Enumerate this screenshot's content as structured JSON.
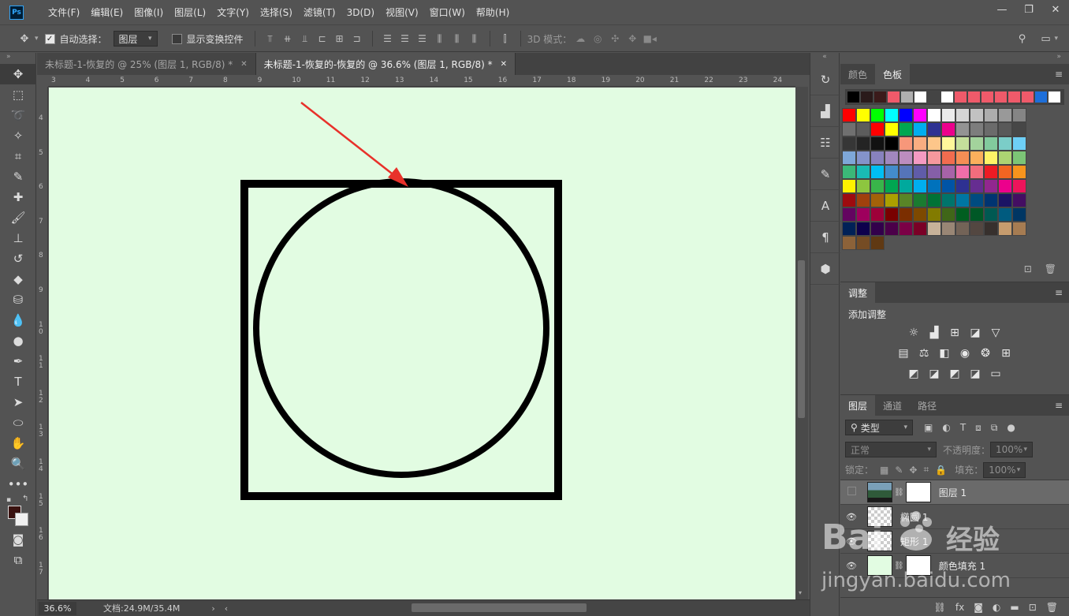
{
  "menubar": {
    "logo": "Ps",
    "items": [
      "文件(F)",
      "编辑(E)",
      "图像(I)",
      "图层(L)",
      "文字(Y)",
      "选择(S)",
      "滤镜(T)",
      "3D(D)",
      "视图(V)",
      "窗口(W)",
      "帮助(H)"
    ],
    "window_controls": [
      "—",
      "❐",
      "✕"
    ]
  },
  "options": {
    "auto_select_label": "自动选择：",
    "auto_select_target": "图层",
    "show_transform_label": "显示变换控件",
    "mode_3d_label": "3D 模式："
  },
  "tabs": [
    {
      "label": "未标题-1-恢复的 @ 25% (图层 1, RGB/8) *",
      "active": false
    },
    {
      "label": "未标题-1-恢复的-恢复的 @ 36.6% (图层 1, RGB/8) *",
      "active": true
    }
  ],
  "rulers": {
    "top": [
      "3",
      "4",
      "5",
      "6",
      "7",
      "8",
      "9",
      "10",
      "11",
      "12",
      "13",
      "14",
      "15",
      "16",
      "17",
      "18",
      "19",
      "20",
      "21",
      "22",
      "23",
      "24"
    ],
    "left": [
      "4",
      "5",
      "6",
      "7",
      "8",
      "9",
      "1\n0",
      "1\n1",
      "1\n2",
      "1\n3",
      "1\n4",
      "1\n5",
      "1\n6",
      "1\n7"
    ]
  },
  "canvas": {
    "background": "#e2fce2",
    "stroke": "#000000",
    "arrow_color": "#e8312a"
  },
  "status": {
    "zoom": "36.6%",
    "doc_info": "文档:24.9M/35.4M"
  },
  "panels": {
    "color_tabs": [
      "颜色",
      "色板"
    ],
    "adjust_tab": "调整",
    "adjust_title": "添加调整",
    "layer_tabs": [
      "图层",
      "通道",
      "路径"
    ],
    "filter_kind": "类型",
    "blend_mode": "正常",
    "opacity_label": "不透明度：",
    "opacity_value": "100%",
    "lock_label": "锁定：",
    "fill_label": "填充：",
    "fill_value": "100%",
    "layers": [
      {
        "name": "图层 1",
        "selected": true,
        "visible": false
      },
      {
        "name": "椭圆 1",
        "selected": false,
        "visible": true
      },
      {
        "name": "矩形 1",
        "selected": false,
        "visible": true
      },
      {
        "name": "颜色填充 1",
        "selected": false,
        "visible": true
      }
    ]
  },
  "swatches": {
    "recent": [
      "#000000",
      "#2a1a1a",
      "#3b1b1b",
      "#ef5a6a",
      "#b0b0b0",
      "#ffffff",
      "#444444",
      "#ffffff",
      "#ef5a6a",
      "#ef5a6a",
      "#ef5a6a",
      "#ef5a6a",
      "#ef5a6a",
      "#ef5a6a",
      "#1e6fd9",
      "#ffffff"
    ],
    "rows": [
      [
        "#ff0000",
        "#ffff00",
        "#00ff00",
        "#00ffff",
        "#0000ff",
        "#ff00ff",
        "#ffffff",
        "#ebebeb",
        "#d6d6d6",
        "#c2c2c2",
        "#adadad",
        "#999999",
        "#858585"
      ],
      [
        "#707070",
        "#5c5c5c",
        "#ff0000",
        "#ffff00",
        "#00a651",
        "#00aeef",
        "#2e3192",
        "#ec008c",
        "#939393",
        "#7d7d7d",
        "#6b6b6b",
        "#595959",
        "#474747"
      ],
      [
        "#363636",
        "#242424",
        "#121212",
        "#000000",
        "#f7977a",
        "#f9ad81",
        "#fdc68a",
        "#fff79a",
        "#c4df9b",
        "#a3d39c",
        "#82ca9d",
        "#7bcdc8",
        "#6ecff6"
      ],
      [
        "#7ea7d8",
        "#8493ca",
        "#8882be",
        "#a187be",
        "#bc8dbf",
        "#f49ac2",
        "#f6989d",
        "#f26c4f",
        "#f68e55",
        "#fbaf5c",
        "#fff467",
        "#acd372",
        "#7cc576"
      ],
      [
        "#3bb878",
        "#1abbb4",
        "#00bff3",
        "#438ccb",
        "#5574b9",
        "#605ca8",
        "#855fa8",
        "#a763a8",
        "#f06ea9",
        "#f26d7d",
        "#ed1c24",
        "#f26522",
        "#f7941d"
      ],
      [
        "#fff200",
        "#8dc63f",
        "#39b54a",
        "#00a651",
        "#00a99d",
        "#00aeef",
        "#0072bc",
        "#0054a6",
        "#2e3192",
        "#662d91",
        "#92278f",
        "#ec008c",
        "#ed145b"
      ],
      [
        "#9e0b0f",
        "#a0410d",
        "#a36209",
        "#aba000",
        "#598527",
        "#1a7b30",
        "#007236",
        "#00746b",
        "#0076a3",
        "#004b80",
        "#003471",
        "#1b1464",
        "#440e62"
      ],
      [
        "#630460",
        "#9e005d",
        "#9e0039",
        "#790000",
        "#7b2e00",
        "#7d4900",
        "#827b00",
        "#406618",
        "#005e20",
        "#005826",
        "#005952",
        "#005b7f",
        "#003663"
      ],
      [
        "#002157",
        "#0d004c",
        "#32004b",
        "#4b0049",
        "#7b0046",
        "#7a0026",
        "#c7b299",
        "#998675",
        "#736357",
        "#534741",
        "#37302d",
        "#c69c6e",
        "#a67c52"
      ],
      [
        "#8c6239",
        "#754c24",
        "#603913"
      ]
    ]
  }
}
